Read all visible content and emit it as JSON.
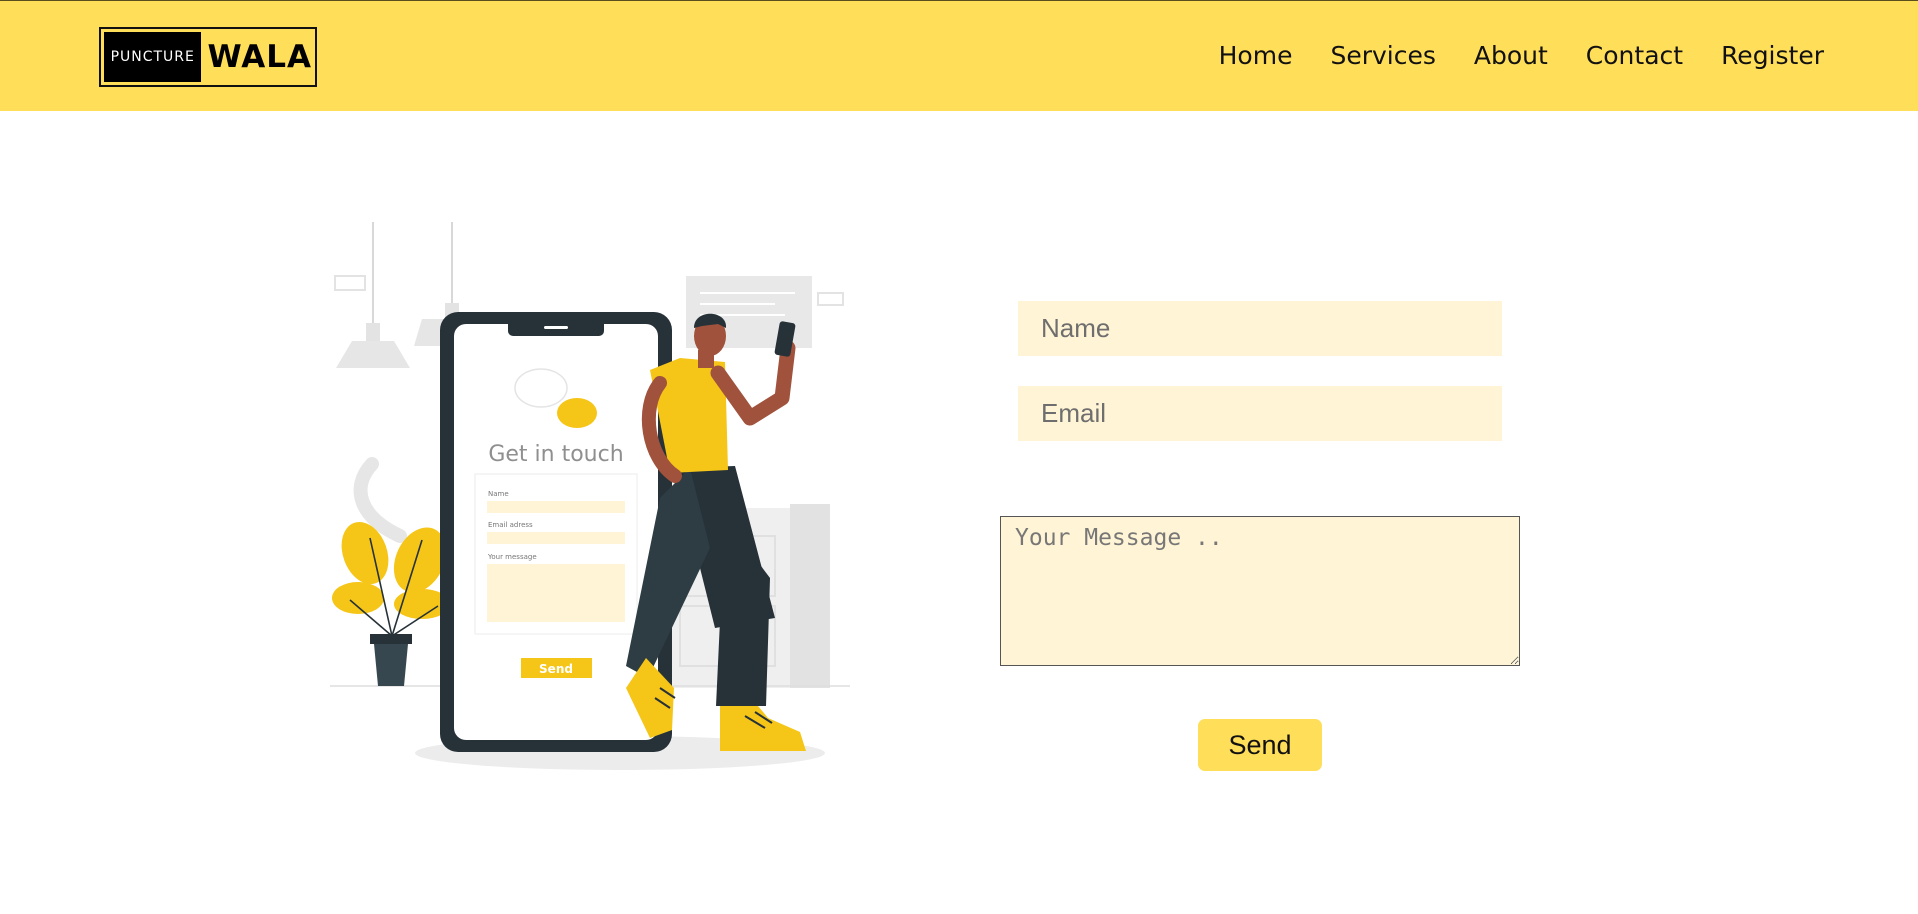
{
  "brand": {
    "left": "PUNCTURE",
    "right": "WALA"
  },
  "nav": [
    {
      "label": "Home"
    },
    {
      "label": "Services"
    },
    {
      "label": "About"
    },
    {
      "label": "Contact"
    },
    {
      "label": "Register"
    }
  ],
  "illustration": {
    "heading": "Get in touch",
    "name_label": "Name",
    "email_label": "Email adress",
    "message_label": "Your message",
    "button": "Send"
  },
  "form": {
    "name_placeholder": "Name",
    "email_placeholder": "Email",
    "message_placeholder": "Your Message ..",
    "send_label": "Send"
  },
  "colors": {
    "brand_yellow": "#ffde59",
    "field_bg": "#fff4d5",
    "phone_dark": "#263238",
    "accent_yellow": "#f5c518"
  }
}
